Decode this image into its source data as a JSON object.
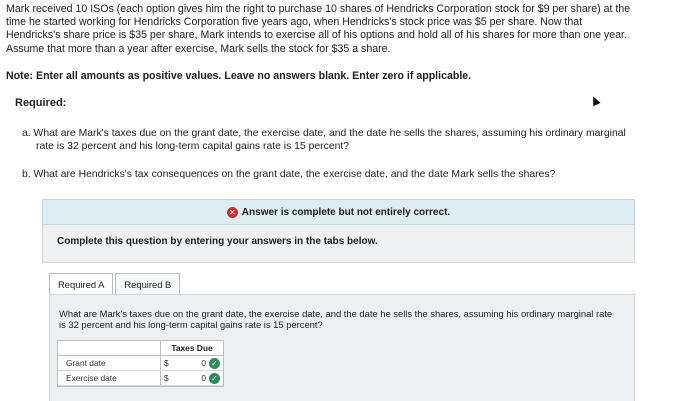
{
  "problem": {
    "lines": [
      "Mark received 10 ISOs (each option gives him the right to purchase 10 shares of Hendricks Corporation stock for $9 per share) at the",
      "time he started working for Hendricks Corporation five years ago, when Hendricks's stock price was $5 per share. Now that",
      "Hendricks's share price is $35 per share, Mark intends to exercise all of his options and hold all of his shares for more than one year.",
      "Assume that more than a year after exercise, Mark sells the stock for $35 a share."
    ],
    "note": "Note: Enter all amounts as positive values. Leave no answers blank. Enter zero if applicable."
  },
  "required": {
    "heading": "Required:",
    "part_a_line1": "a. What are Mark's taxes due on the grant date, the exercise date, and the date he sells the shares, assuming his ordinary marginal",
    "part_a_line2": "rate is 32 percent and his long-term capital gains rate is 15 percent?",
    "part_b": "b. What are Hendricks's tax consequences on the grant date, the exercise date, and the date Mark sells the shares?"
  },
  "status": {
    "icon": "x-circle-icon",
    "text": "Answer is complete but not entirely correct."
  },
  "instructions": "Complete this question by entering your answers in the tabs below.",
  "tabs": [
    {
      "label": "Required A"
    },
    {
      "label": "Required B"
    }
  ],
  "panel": {
    "question": "What are Mark's taxes due on the grant date, the exercise date, and the date he sells the shares, assuming his ordinary marginal rate is 32 percent and his long-term capital gains rate is 15 percent?",
    "table": {
      "column_header": "Taxes Due",
      "rows": [
        {
          "label": "Grant date",
          "currency": "$",
          "value": "0",
          "status_icon": "check-circle-icon"
        },
        {
          "label": "Exercise date",
          "currency": "$",
          "value": "0",
          "status_icon": "check-circle-icon"
        }
      ]
    }
  },
  "colors": {
    "status_bg": "#dcedf3",
    "error_red": "#c9302c",
    "correct_green": "#2e8b57",
    "panel_bg": "#edf0f2"
  }
}
